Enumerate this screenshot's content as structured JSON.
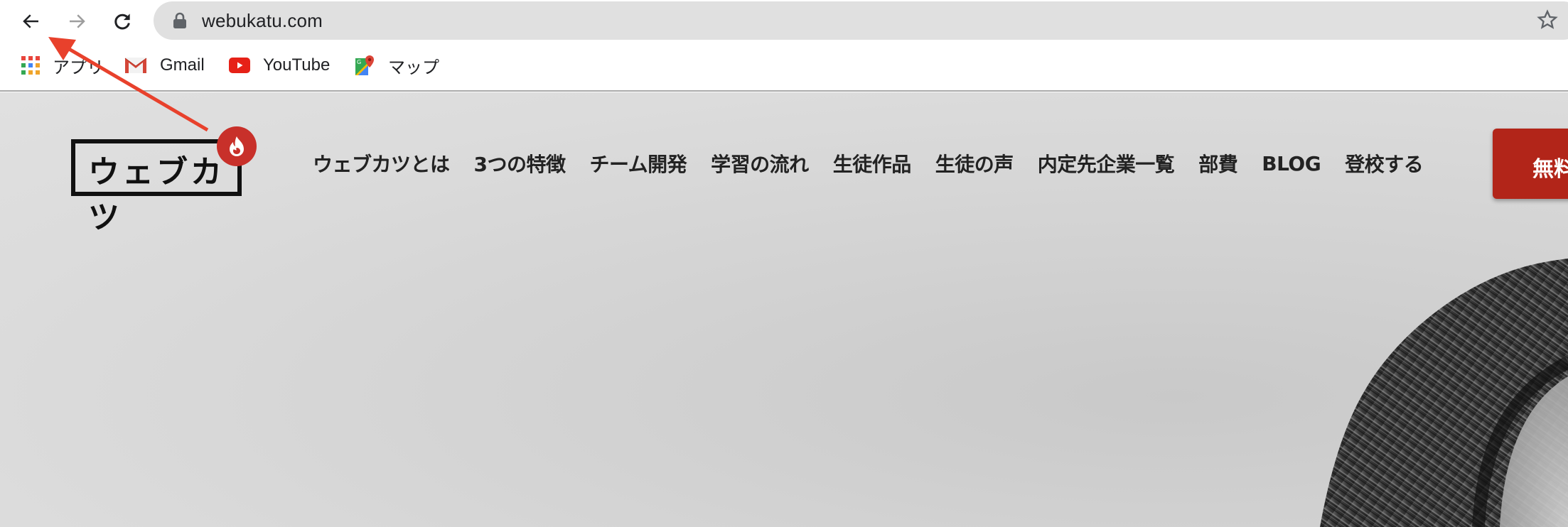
{
  "browser": {
    "url": "webukatu.com",
    "back_label": "Back",
    "forward_label": "Forward",
    "reload_label": "Reload",
    "bookmark_star_label": "Bookmark this tab"
  },
  "bookmarks": [
    {
      "label": "アプリ",
      "icon": "apps-grid-icon"
    },
    {
      "label": "Gmail",
      "icon": "gmail-icon"
    },
    {
      "label": "YouTube",
      "icon": "youtube-icon"
    },
    {
      "label": "マップ",
      "icon": "google-maps-icon"
    }
  ],
  "site": {
    "logo_text": "ウェブカツ",
    "nav": [
      "ウェブカツとは",
      "3つの特徴",
      "チーム開発",
      "学習の流れ",
      "生徒作品",
      "生徒の声",
      "内定先企業一覧",
      "部費",
      "BLOG",
      "登校する"
    ],
    "cta_label": "無料"
  },
  "colors": {
    "brand_red": "#c8302a",
    "cta_red": "#b22519",
    "annotation_red": "#e8412c"
  }
}
